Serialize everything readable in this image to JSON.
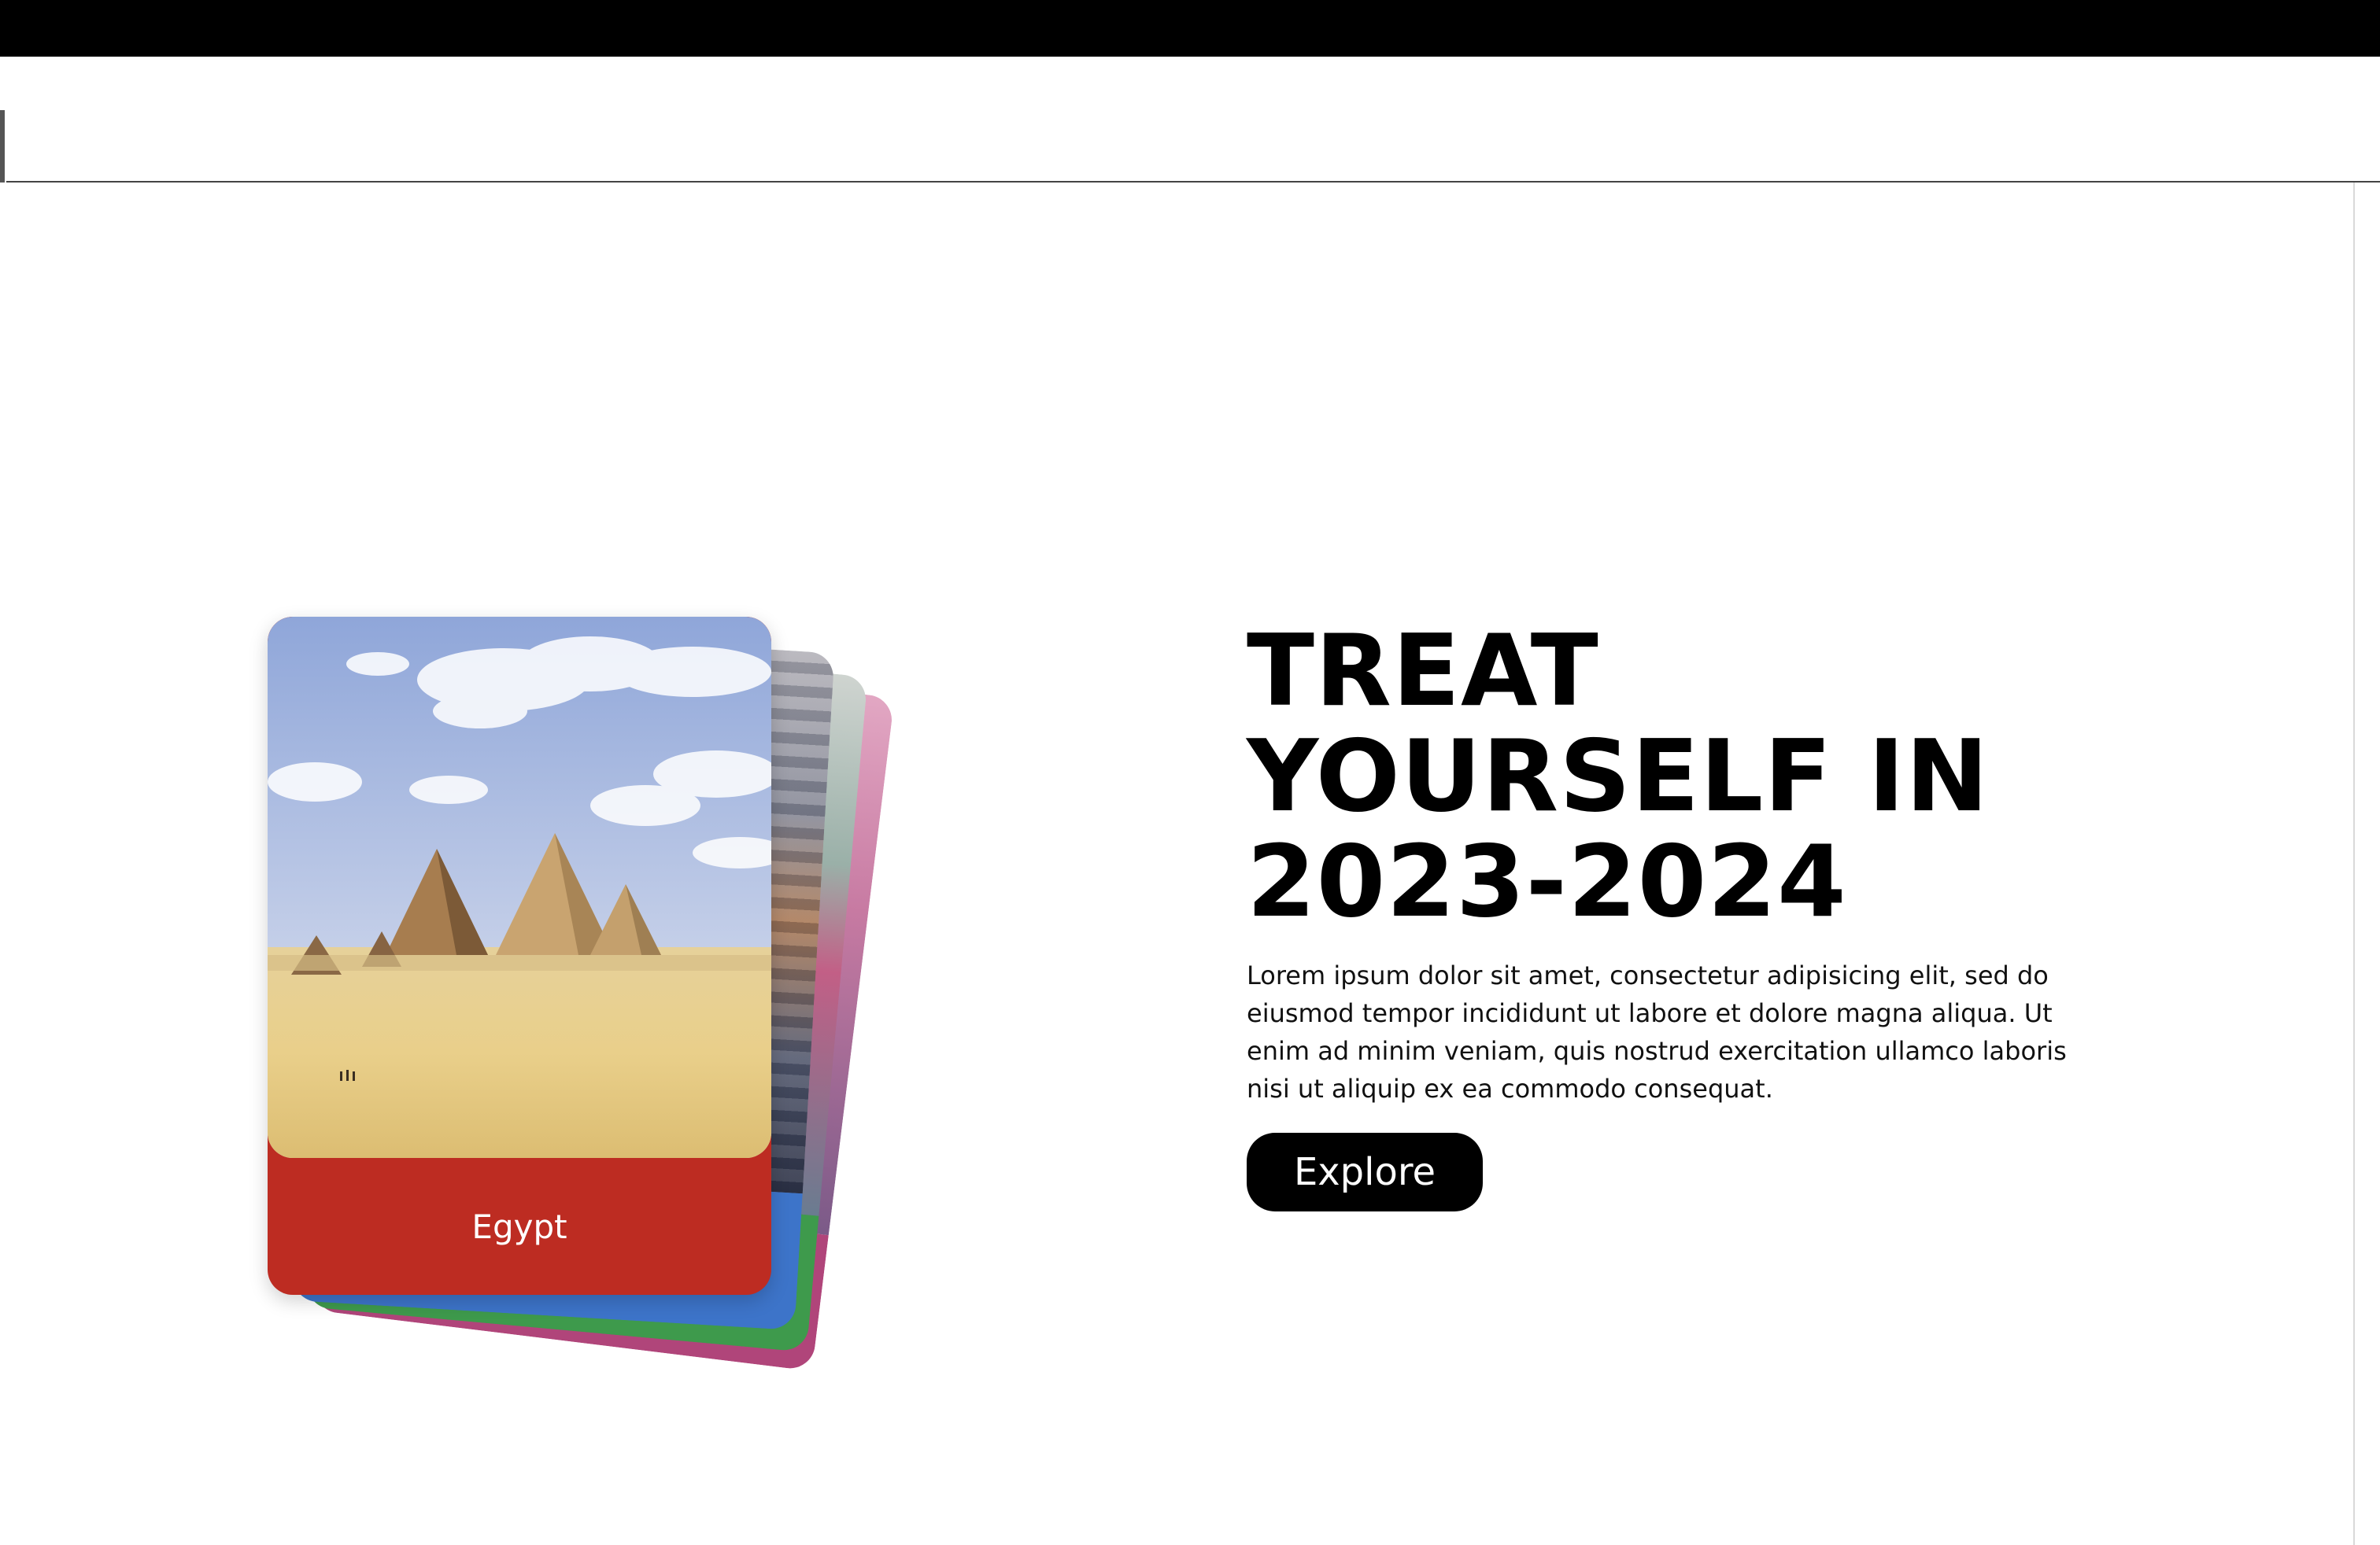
{
  "hero": {
    "title_lines": [
      "TREAT",
      "YOURSELF IN",
      "2023-2024"
    ],
    "description": "Lorem ipsum dolor sit amet, consectetur adipisicing elit, sed do eiusmod tempor incididunt ut labore et dolore magna aliqua. Ut enim ad minim veniam, quis nostrud exercitation ullamco laboris nisi ut aliquip ex ea commodo consequat.",
    "explore_label": "Explore"
  },
  "cards": {
    "front": {
      "label": "Egypt",
      "band_color": "#bd2c22",
      "image": "pyramids-photo"
    },
    "stacked_band_colors": [
      "#3d74c9",
      "#3e9a4c",
      "#b0457a"
    ]
  },
  "colors": {
    "title": "#000000",
    "button_bg": "#000000",
    "button_text": "#ffffff"
  }
}
